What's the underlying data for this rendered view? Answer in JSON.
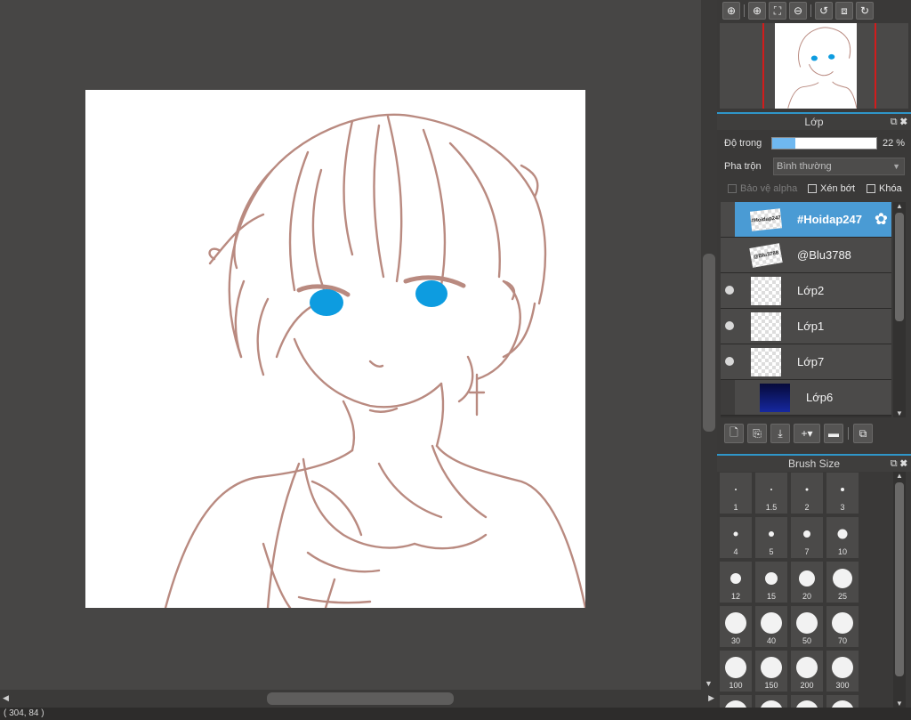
{
  "status_bar": {
    "coordinates": "( 304, 84 )"
  },
  "navigator": {
    "tools": [
      {
        "icon": "zoom-actual-icon",
        "glyph": "⊕"
      },
      {
        "icon": "zoom-in-icon",
        "glyph": "⊕"
      },
      {
        "icon": "fit-screen-icon",
        "glyph": "⛶"
      },
      {
        "icon": "zoom-out-icon",
        "glyph": "⊖"
      },
      {
        "icon": "rotate-left-icon",
        "glyph": "↺"
      },
      {
        "icon": "flip-icon",
        "glyph": "⧈"
      },
      {
        "icon": "rotate-right-icon",
        "glyph": "↻"
      }
    ]
  },
  "layer_panel": {
    "title": "Lớp",
    "opacity_label": "Độ trong",
    "opacity_value": "22 %",
    "opacity_fraction": 0.22,
    "blend_label": "Pha trộn",
    "blend_value": "Bình thường",
    "checkbox_alpha": "Bảo vệ alpha",
    "checkbox_clip": "Xén bớt",
    "checkbox_lock": "Khóa",
    "layers": [
      {
        "name": "#Hoidap247",
        "thumb_text": "#Hoidap247",
        "selected": true,
        "visible": false
      },
      {
        "name": "@Blu3788",
        "thumb_text": "@Blu3788",
        "selected": false,
        "visible": false
      },
      {
        "name": "Lớp2",
        "selected": false,
        "visible": true
      },
      {
        "name": "Lớp1",
        "selected": false,
        "visible": true
      },
      {
        "name": "Lớp7",
        "selected": false,
        "visible": true
      },
      {
        "name": "Lớp6",
        "selected": false,
        "visible": false,
        "dark": true
      }
    ]
  },
  "brush_panel": {
    "title": "Brush Size",
    "sizes": [
      "1",
      "1.5",
      "2",
      "3",
      "4",
      "5",
      "7",
      "10",
      "12",
      "15",
      "20",
      "25",
      "30",
      "40",
      "50",
      "70",
      "100",
      "150",
      "200",
      "300"
    ]
  },
  "colors": {
    "accent": "#2f96c9",
    "selected_layer": "#4a9bd4",
    "line_art": "#b98a80",
    "eye": "#0d9ce0"
  }
}
